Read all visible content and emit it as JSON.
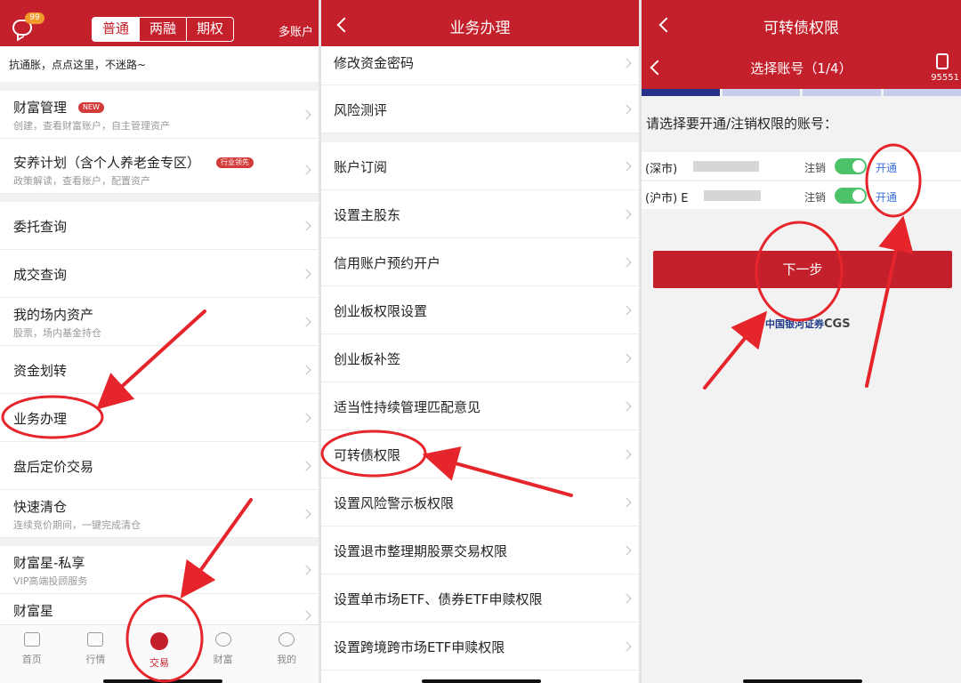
{
  "panel1": {
    "badge": "99",
    "segments": [
      "普通",
      "两融",
      "期权"
    ],
    "multi_account": "多账户",
    "notice": "抗通胀，点点这里，不迷路~",
    "items": [
      {
        "title": "财富管理",
        "tag": "NEW",
        "sub": "创建，查看财富账户，自主管理资产"
      },
      {
        "title": "安养计划（含个人养老金专区）",
        "tag": "行业领先",
        "sub": "政策解读，查看账户，配置资产"
      },
      {
        "title": "委托查询"
      },
      {
        "title": "成交查询"
      },
      {
        "title": "我的场内资产",
        "sub": "股票，场内基金持仓"
      },
      {
        "title": "资金划转"
      },
      {
        "title": "业务办理"
      },
      {
        "title": "盘后定价交易"
      },
      {
        "title": "快速清仓",
        "sub": "连续竞价期间，一键完成清仓"
      },
      {
        "title": "财富星-私享",
        "sub": "VIP高端投顾服务"
      },
      {
        "title": "财富星"
      }
    ],
    "tabs": [
      "首页",
      "行情",
      "交易",
      "财富",
      "我的"
    ]
  },
  "panel2": {
    "title": "业务办理",
    "items": [
      "修改资金密码",
      "风险测评",
      "账户订阅",
      "设置主股东",
      "信用账户预约开户",
      "创业板权限设置",
      "创业板补签",
      "适当性持续管理匹配意见",
      "可转债权限",
      "设置风险警示板权限",
      "设置退市整理期股票交易权限",
      "设置单市场ETF、债券ETF申赎权限",
      "设置跨境跨市场ETF申赎权限"
    ]
  },
  "panel3": {
    "title": "可转债权限",
    "subtitle": "选择账号（1/4）",
    "hotline": "95551",
    "prompt": "请选择要开通/注销权限的账号：",
    "accounts": [
      {
        "market": "(深市)",
        "cancel": "注销",
        "open": "开通"
      },
      {
        "market": "(沪市) E",
        "cancel": "注销",
        "open": "开通"
      }
    ],
    "next": "下一步",
    "logo_cn": "中国银河证券",
    "logo_en": "CGS"
  },
  "colors": {
    "brand_red": "#c4202b",
    "link_blue": "#3a6fd8",
    "toggle_green": "#4cc36a",
    "progress_active": "#27318a"
  }
}
